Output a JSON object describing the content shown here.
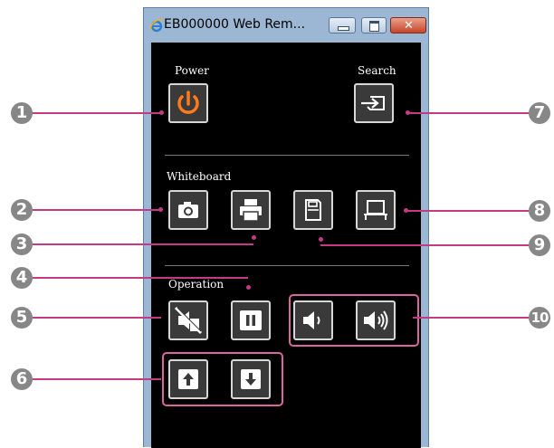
{
  "window": {
    "title": "EB000000 Web Rem...",
    "close_glyph": "✕"
  },
  "labels": {
    "power": "Power",
    "search": "Search",
    "whiteboard": "Whiteboard",
    "operation": "Operation"
  },
  "icons": {
    "power": "power-icon",
    "search": "source-search-icon",
    "capture": "camera-icon",
    "print": "printer-icon",
    "save": "save-document-icon",
    "display": "display-screen-icon",
    "av_mute": "av-mute-icon",
    "freeze": "pause-icon",
    "volume_down": "volume-down-icon",
    "volume_up": "volume-up-icon",
    "page_up": "arrow-up-icon",
    "page_down": "arrow-down-icon"
  },
  "colors": {
    "accent": "#d9669e",
    "power_orange": "#ff7b1c",
    "panel": "#000000"
  },
  "callouts": [
    "1",
    "2",
    "3",
    "4",
    "5",
    "6",
    "7",
    "8",
    "9",
    "10"
  ]
}
